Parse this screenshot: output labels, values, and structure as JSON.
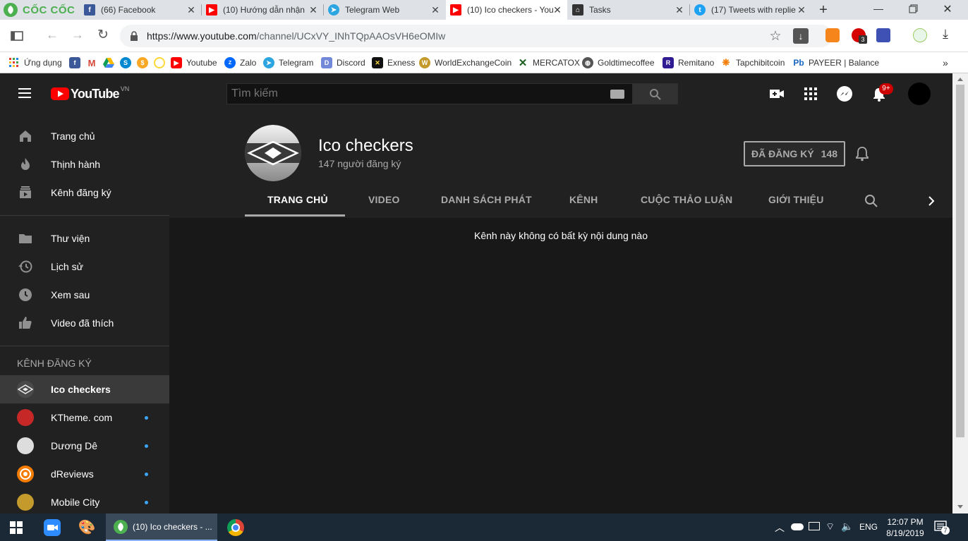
{
  "browser": {
    "brand": "CỐC CỐC",
    "tabs": [
      {
        "label": "(66) Facebook",
        "icon": "facebook-icon"
      },
      {
        "label": "(10) Hướng dẫn nhận",
        "icon": "youtube-icon"
      },
      {
        "label": "Telegram Web",
        "icon": "telegram-icon"
      },
      {
        "label": "(10) Ico checkers - You",
        "icon": "youtube-icon",
        "active": true
      },
      {
        "label": "Tasks",
        "icon": "tasks-icon"
      },
      {
        "label": "(17) Tweets with replie",
        "icon": "twitter-icon"
      }
    ],
    "url_host": "https://www.youtube.com",
    "url_path": "/channel/UCxVY_INhTQpAAOsVH6eOMIw",
    "extension_badge": "3",
    "bookmarks": [
      {
        "label": "Ứng dụng"
      },
      {
        "label": ""
      },
      {
        "label": ""
      },
      {
        "label": ""
      },
      {
        "label": ""
      },
      {
        "label": ""
      },
      {
        "label": ""
      },
      {
        "label": "Youtube"
      },
      {
        "label": "Zalo"
      },
      {
        "label": "Telegram"
      },
      {
        "label": "Discord"
      },
      {
        "label": "Exness"
      },
      {
        "label": "WorldExchangeCoin"
      },
      {
        "label": "MERCATOX"
      },
      {
        "label": "Goldtimecoffee"
      },
      {
        "label": "Remitano"
      },
      {
        "label": "Tapchibitcoin"
      },
      {
        "label": "PAYEER | Balance"
      }
    ],
    "bookmarks_overflow": "»"
  },
  "youtube": {
    "logo_text": "YouTube",
    "logo_region": "VN",
    "search_placeholder": "Tìm kiếm",
    "notification_badge": "9+",
    "sidebar": {
      "primary": [
        {
          "label": "Trang chủ",
          "icon": "home-icon"
        },
        {
          "label": "Thịnh hành",
          "icon": "trending-icon"
        },
        {
          "label": "Kênh đăng ký",
          "icon": "subscriptions-icon"
        }
      ],
      "library": [
        {
          "label": "Thư viện",
          "icon": "library-folder-icon"
        },
        {
          "label": "Lịch sử",
          "icon": "history-icon"
        },
        {
          "label": "Xem sau",
          "icon": "watch-later-icon"
        },
        {
          "label": "Video đã thích",
          "icon": "thumbs-up-icon"
        }
      ],
      "subscriptions_heading": "KÊNH ĐĂNG KÝ",
      "subscriptions": [
        {
          "label": "Ico checkers",
          "active": true,
          "avatar_color": "#555555"
        },
        {
          "label": "KTheme. com",
          "avatar_color": "#c62828"
        },
        {
          "label": "Dương Dê",
          "avatar_color": "#dddddd"
        },
        {
          "label": "dReviews",
          "avatar_color": "#f57c00"
        },
        {
          "label": "Mobile City",
          "avatar_color": "#c49a2c"
        }
      ]
    },
    "channel": {
      "name": "Ico checkers",
      "subscribers": "147 người đăng ký",
      "subscribed_label": "ĐÃ ĐĂNG KÝ",
      "subscribed_count": "148",
      "tabs": [
        "TRANG CHỦ",
        "VIDEO",
        "DANH SÁCH PHÁT",
        "KÊNH",
        "CUỘC THẢO LUẬN",
        "GIỚI THIỆU"
      ],
      "active_tab": "TRANG CHỦ",
      "empty_message": "Kênh này không có bất kỳ nội dung nào"
    }
  },
  "taskbar": {
    "active_window": "(10) Ico checkers - ...",
    "language": "ENG",
    "time": "12:07 PM",
    "date": "8/19/2019",
    "notification_count": "7"
  },
  "colors": {
    "yt_header": "#212121",
    "yt_background": "#181818",
    "youtube_red": "#ff0000",
    "accent_blue": "#3ea6ff"
  }
}
